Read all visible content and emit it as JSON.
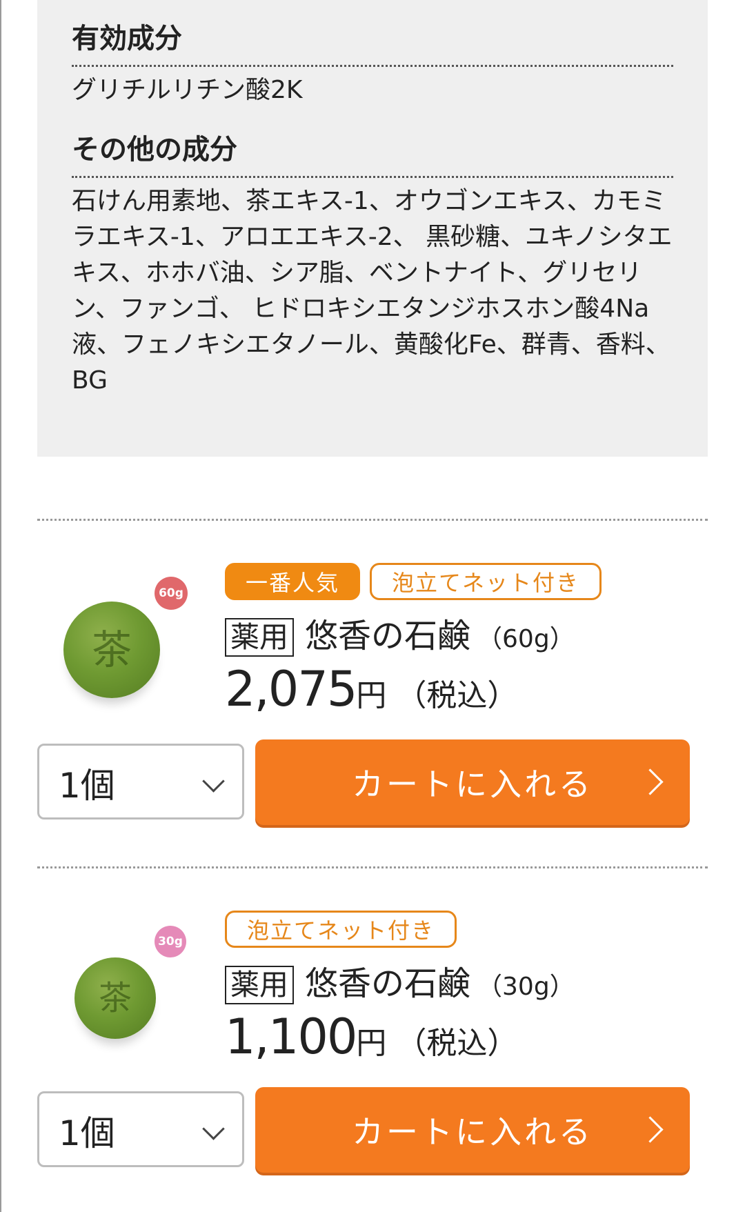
{
  "ingredients": {
    "active_heading": "有効成分",
    "active_text": "グリチルリチン酸2K",
    "other_heading": "その他の成分",
    "other_text": "石けん用素地、茶エキス-1、オウゴンエキス、カモミラエキス-1、アロエエキス-2、 黒砂糖、ユキノシタエキス、ホホバ油、シア脂、ベントナイト、グリセリン、ファンゴ、 ヒドロキシエタンジホスホン酸4Na液、フェノキシエタノール、黄酸化Fe、群青、香料、BG"
  },
  "products": [
    {
      "badge": "60g",
      "badge_color": "#e0686b",
      "tag_popular": "一番人気",
      "tag_net": "泡立てネット付き",
      "prefix": "薬用",
      "name": "悠香の石鹸",
      "size": "（60g）",
      "price": "2,075",
      "yen": "円",
      "tax": "（税込）",
      "qty": "1個",
      "cart_label": "カートに入れる"
    },
    {
      "badge": "30g",
      "badge_color": "#e58ab8",
      "tag_net": "泡立てネット付き",
      "prefix": "薬用",
      "name": "悠香の石鹸",
      "size": "（30g）",
      "price": "1,100",
      "yen": "円",
      "tax": "（税込）",
      "qty": "1個",
      "cart_label": "カートに入れる"
    }
  ],
  "colors": {
    "accent": "#f47a1f",
    "tag_orange": "#f08a12",
    "panel_bg": "#efefef"
  }
}
